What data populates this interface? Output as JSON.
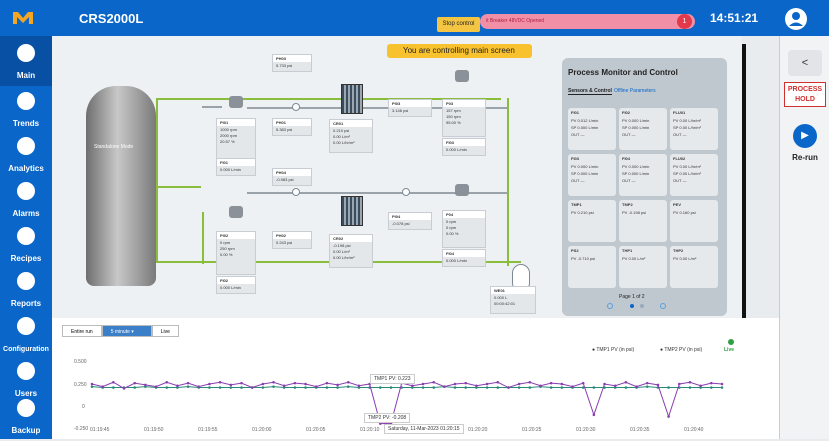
{
  "topbar": {
    "title": "CRS2000L",
    "stop_control": "Stop control",
    "alert_text": "it Breaker 48VDC Opened",
    "alert_count": "1",
    "clock": "14:51:21"
  },
  "sidebar": {
    "items": [
      {
        "label": "Main",
        "icon": "home-icon",
        "active": true
      },
      {
        "label": "Trends",
        "icon": "pulse-icon",
        "active": false
      },
      {
        "label": "Analytics",
        "icon": "analytics-icon",
        "active": false
      },
      {
        "label": "Alarms",
        "icon": "alarm-icon",
        "active": false
      },
      {
        "label": "Recipes",
        "icon": "recipe-icon",
        "active": false
      },
      {
        "label": "Reports",
        "icon": "report-icon",
        "active": false
      },
      {
        "label": "Configuration",
        "icon": "config-icon",
        "active": false
      },
      {
        "label": "Users",
        "icon": "users-icon",
        "active": false
      },
      {
        "label": "Backup",
        "icon": "backup-icon",
        "active": false
      }
    ]
  },
  "rightpanel": {
    "back": "<",
    "process_hold": "PROCESS HOLD",
    "rerun": "Re-run"
  },
  "schematic": {
    "banner": "You are controlling main screen",
    "tank_label": "Standalone Mode",
    "cards": {
      "PI01": {
        "title": "PI01",
        "pv": "1000 rpm",
        "sp": "2000 rpm",
        "out": "20.57 %",
        "tag": "Speed rpm"
      },
      "PI02": {
        "title": "PI02",
        "pv": "0 rpm",
        "sp": "250 rpm",
        "out": "0.00 %",
        "tag": "Speed rpm"
      },
      "FI01": {
        "title": "FI01",
        "pv": "0.000 L/min"
      },
      "FI02": {
        "title": "FI02",
        "pv": "0.000 L/min"
      },
      "PH01": {
        "title": "PH01",
        "pv": "5.383 psi"
      },
      "PH02": {
        "title": "PH02",
        "pv": "0.243 psi"
      },
      "CR01": {
        "title": "CR01",
        "sp": "0.210 psi",
        "t": "0.00 L/m²",
        "flux": "0.00 L/hr/m²"
      },
      "CR02": {
        "title": "CR02",
        "sp": "-0.198 psi",
        "t": "0.00 L/m²",
        "flux": "0.00 L/hr/m²"
      },
      "PI03": {
        "title": "PI03",
        "pv": "3.146 psi"
      },
      "PI04": {
        "title": "PI04",
        "pv": "-0.078 psi"
      },
      "P03": {
        "title": "P03",
        "pv": "157 rpm",
        "sp": "150 rpm",
        "out": "95.00 %"
      },
      "P04": {
        "title": "P04",
        "pv": "0 rpm",
        "sp": "0 rpm",
        "out": "0.00 %"
      },
      "FI03": {
        "title": "FI03",
        "pv": "0.000 L/min"
      },
      "FI04": {
        "title": "FI04",
        "pv": "0.000 L/min"
      },
      "PH03": {
        "title": "PH03",
        "pv": "5.733 psi"
      },
      "PH04": {
        "title": "PH04",
        "pv": "-0.983 psi"
      },
      "WE01": {
        "title": "WE01",
        "volume": "0.000 L",
        "time": "00:00:42:01"
      }
    }
  },
  "process_monitor": {
    "title": "Process Monitor and Control",
    "tab_active": "Sensors & Control",
    "tab_inactive": "Offline Parameters",
    "cards": [
      {
        "title": "FI01",
        "r1": "PV 0.012 L/min",
        "r2": "SP 0.000 L/min",
        "r3": "OUT —"
      },
      {
        "title": "FI02",
        "r1": "PV 0.000 L/min",
        "r2": "SP 0.000 L/min",
        "r3": "OUT —"
      },
      {
        "title": "FLU01",
        "r1": "PV 0.00 L/hr/m²",
        "r2": "SP 0.00 L/hr/m²",
        "r3": "OUT —"
      },
      {
        "title": "FI03",
        "r1": "PV 0.000 L/min",
        "r2": "SP 0.000 L/min",
        "r3": "OUT —"
      },
      {
        "title": "FI04",
        "r1": "PV 0.000 L/min",
        "r2": "SP 0.000 L/min",
        "r3": "OUT —"
      },
      {
        "title": "FLU02",
        "r1": "PV 0.00 L/hr/m²",
        "r2": "SP 0.00 L/hr/m²",
        "r3": "OUT —"
      },
      {
        "title": "TMP1",
        "r1": "PV 0.210 psi",
        "r2": "",
        "r3": ""
      },
      {
        "title": "TMP2",
        "r1": "PV -0.198 psi",
        "r2": "",
        "r3": ""
      },
      {
        "title": "PEV",
        "r1": "PV 0.160 psi",
        "r2": "",
        "r3": ""
      },
      {
        "title": "PS2",
        "r1": "PV -0.710 psi",
        "r2": "",
        "r3": ""
      },
      {
        "title": "THP1",
        "r1": "PV 0.00 L/m²",
        "r2": "",
        "r3": ""
      },
      {
        "title": "THP2",
        "r1": "PV 0.00 L/m²",
        "r2": "",
        "r3": ""
      }
    ],
    "page": "Page 1 of 2"
  },
  "chart_controls": {
    "entire_run": "Entire run",
    "range": "5 minute",
    "live": "Live",
    "live_status": "Live"
  },
  "chart_data": {
    "type": "line",
    "series": [
      {
        "name": "TMP1 PV (in psi)",
        "color": "#2a8a7a",
        "values": [
          0.22,
          0.21,
          0.21,
          0.21,
          0.21,
          0.22,
          0.21,
          0.21,
          0.21,
          0.22,
          0.21,
          0.21,
          0.21,
          0.21,
          0.21,
          0.21,
          0.21,
          0.22,
          0.21,
          0.21,
          0.21,
          0.21,
          0.21,
          0.21,
          0.22,
          0.21,
          0.21,
          0.21,
          0.21,
          0.21,
          0.21,
          0.21,
          0.21,
          0.22,
          0.21,
          0.21,
          0.21,
          0.21,
          0.21,
          0.21,
          0.21,
          0.21,
          0.22,
          0.21,
          0.21,
          0.21,
          0.21,
          0.21,
          0.21,
          0.21,
          0.21,
          0.21,
          0.22,
          0.21,
          0.21,
          0.21,
          0.21,
          0.21,
          0.21,
          0.21
        ]
      },
      {
        "name": "TMP2 PV (in psi)",
        "color": "#8a3db0",
        "values": [
          0.25,
          0.22,
          0.27,
          0.2,
          0.26,
          0.24,
          0.22,
          0.27,
          0.23,
          0.26,
          0.22,
          0.25,
          0.27,
          0.24,
          0.26,
          0.21,
          0.25,
          0.27,
          0.23,
          0.26,
          0.25,
          0.22,
          0.26,
          0.24,
          0.27,
          0.23,
          0.25,
          -0.2,
          -0.198,
          0.26,
          0.23,
          0.25,
          0.27,
          0.22,
          0.25,
          0.26,
          0.23,
          0.25,
          0.27,
          0.21,
          0.25,
          0.27,
          0.23,
          0.26,
          0.25,
          0.22,
          0.26,
          -0.1,
          0.25,
          0.23,
          0.27,
          0.22,
          0.26,
          0.24,
          -0.12,
          0.25,
          0.27,
          0.23,
          0.26,
          0.25
        ]
      }
    ],
    "yticks": [
      "0.500",
      "0.250",
      "0",
      "-0.250"
    ],
    "ylim": [
      -0.25,
      0.5
    ],
    "xticks": [
      "01:19:45",
      "01:19:50",
      "01:19:55",
      "01:20:00",
      "01:20:05",
      "01:20:10",
      "01:20:15",
      "01:20:20",
      "01:20:25",
      "01:20:30",
      "01:20:35",
      "01:20:40"
    ],
    "tooltip1": "TMP1 PV: 0.223",
    "tooltip2": "TMP2 PV: -0.208",
    "tooltip_date": "Saturday, 11-Mar-2023 01:20:15"
  },
  "colors": {
    "primary": "#0a66c9",
    "pipe": "#8bbd3c",
    "alert": "#e23a4a"
  }
}
